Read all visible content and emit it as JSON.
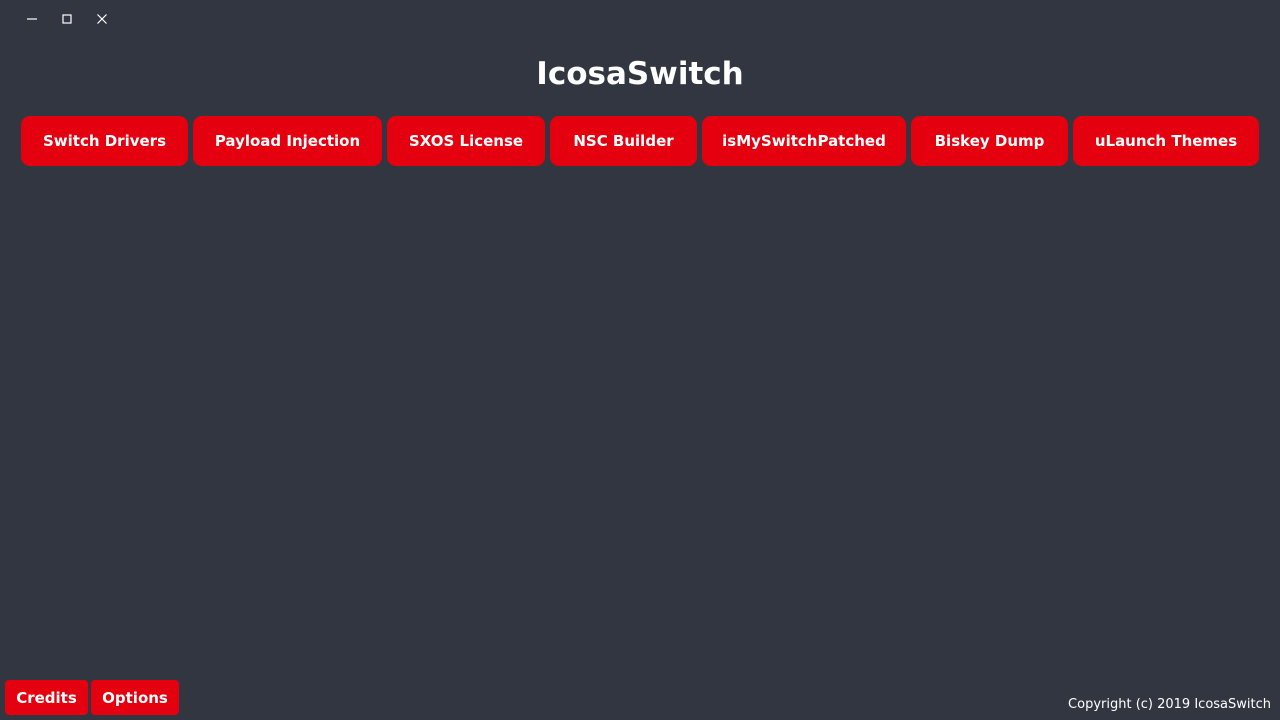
{
  "window": {
    "controls": {
      "minimize_icon": "minimize-icon",
      "maximize_icon": "maximize-icon",
      "close_icon": "close-icon"
    }
  },
  "app": {
    "title": "IcosaSwitch",
    "accent_color": "#e4000f",
    "background_color": "#313640"
  },
  "nav": {
    "items": [
      {
        "label": "Switch Drivers"
      },
      {
        "label": "Payload Injection"
      },
      {
        "label": "SXOS License"
      },
      {
        "label": "NSC Builder"
      },
      {
        "label": "isMySwitchPatched"
      },
      {
        "label": "Biskey Dump"
      },
      {
        "label": "uLaunch Themes"
      }
    ]
  },
  "footer": {
    "credits_label": "Credits",
    "options_label": "Options",
    "copyright": "Copyright (c) 2019 IcosaSwitch"
  }
}
